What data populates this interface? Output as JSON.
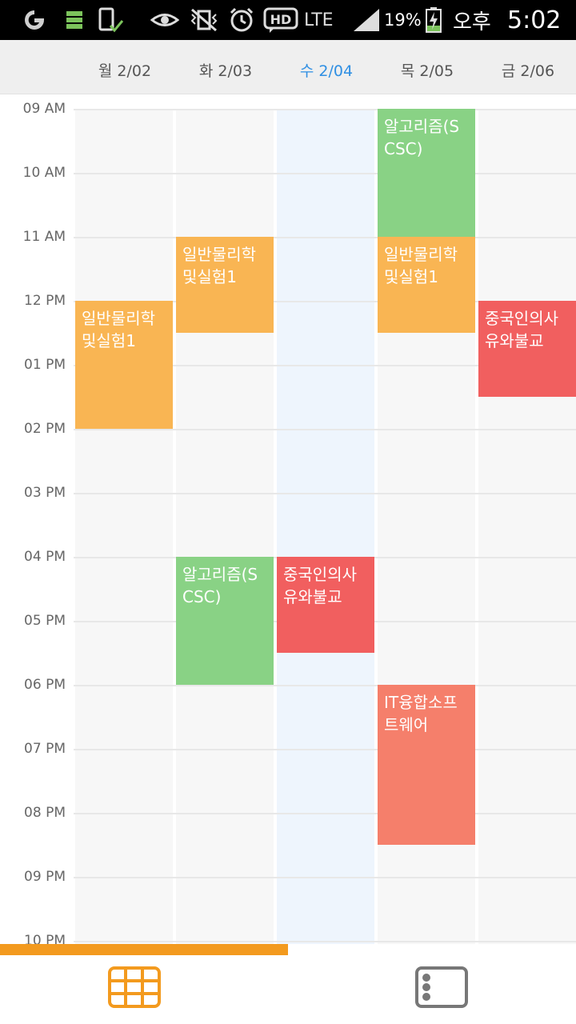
{
  "status_bar": {
    "battery_percent": "19%",
    "network": "LTE",
    "ampm": "오후",
    "time": "5:02"
  },
  "days": [
    {
      "label": "월 2/02",
      "today": false
    },
    {
      "label": "화 2/03",
      "today": false
    },
    {
      "label": "수 2/04",
      "today": true
    },
    {
      "label": "목 2/05",
      "today": false
    },
    {
      "label": "금 2/06",
      "today": false
    }
  ],
  "time_labels": [
    "09 AM",
    "10 AM",
    "11 AM",
    "12 PM",
    "01 PM",
    "02 PM",
    "03 PM",
    "04 PM",
    "05 PM",
    "06 PM",
    "07 PM",
    "08 PM",
    "09 PM",
    "10 PM"
  ],
  "events": [
    {
      "title": "일반물리학및실험1",
      "day": 0,
      "start": 12.0,
      "end": 14.0,
      "color": "#f9b553"
    },
    {
      "title": "일반물리학및실험1",
      "day": 1,
      "start": 11.0,
      "end": 12.5,
      "color": "#f9b553"
    },
    {
      "title": "알고리즘(SCSC)",
      "day": 1,
      "start": 16.0,
      "end": 18.0,
      "color": "#89d285"
    },
    {
      "title": "중국인의사유와불교",
      "day": 2,
      "start": 16.0,
      "end": 17.5,
      "color": "#f15f5f"
    },
    {
      "title": "알고리즘(SCSC)",
      "day": 3,
      "start": 9.0,
      "end": 11.0,
      "color": "#89d285"
    },
    {
      "title": "일반물리학및실험1",
      "day": 3,
      "start": 11.0,
      "end": 12.5,
      "color": "#f9b553"
    },
    {
      "title": "IT융합소프트웨어",
      "day": 3,
      "start": 18.0,
      "end": 20.5,
      "color": "#f57f6b"
    },
    {
      "title": "중국인의사유와불교",
      "day": 4,
      "start": 12.0,
      "end": 13.5,
      "color": "#f15f5f"
    }
  ],
  "scroll_progress": 0.5,
  "colors": {
    "accent": "#f39a1e",
    "today_text": "#2f8fe3",
    "today_column": "#eef5fd"
  },
  "nav": {
    "week_view_icon": "grid-calendar-icon",
    "list_view_icon": "list-view-icon"
  }
}
